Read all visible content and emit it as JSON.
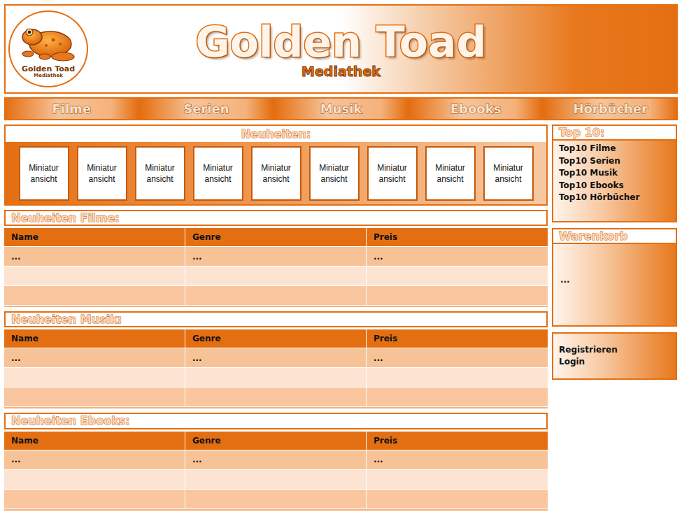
{
  "header": {
    "logo": {
      "title": "Golden Toad",
      "subtitle": "Mediathek"
    },
    "title": "Golden Toad",
    "subtitle": "Mediathek"
  },
  "nav": [
    {
      "label": "Filme"
    },
    {
      "label": "Serien"
    },
    {
      "label": "Musik"
    },
    {
      "label": "Ebooks"
    },
    {
      "label": "Hörbücher"
    }
  ],
  "news": {
    "title": "Neuheiten:",
    "thumbnails": [
      "Miniatur ansicht",
      "Miniatur ansicht",
      "Miniatur ansicht",
      "Miniatur ansicht",
      "Miniatur ansicht",
      "Miniatur ansicht",
      "Miniatur ansicht",
      "Miniatur ansicht",
      "Miniatur ansicht"
    ]
  },
  "sections": [
    {
      "title": "Neuheiten Filme:",
      "columns": [
        "Name",
        "Genre",
        "Preis"
      ],
      "rows": [
        [
          "...",
          "...",
          "..."
        ],
        [
          "",
          "",
          ""
        ],
        [
          "",
          "",
          ""
        ]
      ]
    },
    {
      "title": "Neuheiten Musik:",
      "columns": [
        "Name",
        "Genre",
        "Preis"
      ],
      "rows": [
        [
          "...",
          "...",
          "..."
        ],
        [
          "",
          "",
          ""
        ],
        [
          "",
          "",
          ""
        ]
      ]
    },
    {
      "title": "Neuheiten Ebooks:",
      "columns": [
        "Name",
        "Genre",
        "Preis"
      ],
      "rows": [
        [
          "...",
          "...",
          "..."
        ],
        [
          "",
          "",
          ""
        ],
        [
          "",
          "",
          ""
        ]
      ]
    }
  ],
  "sidebar": {
    "top10": {
      "title": "Top 10:",
      "items": [
        "Top10 Filme",
        "Top10 Serien",
        "Top10 Musik",
        "Top10 Ebooks",
        "Top10 Hörbücher"
      ]
    },
    "cart": {
      "title": "Warenkorb",
      "content": "..."
    },
    "account": [
      "Registrieren",
      "Login"
    ]
  }
}
